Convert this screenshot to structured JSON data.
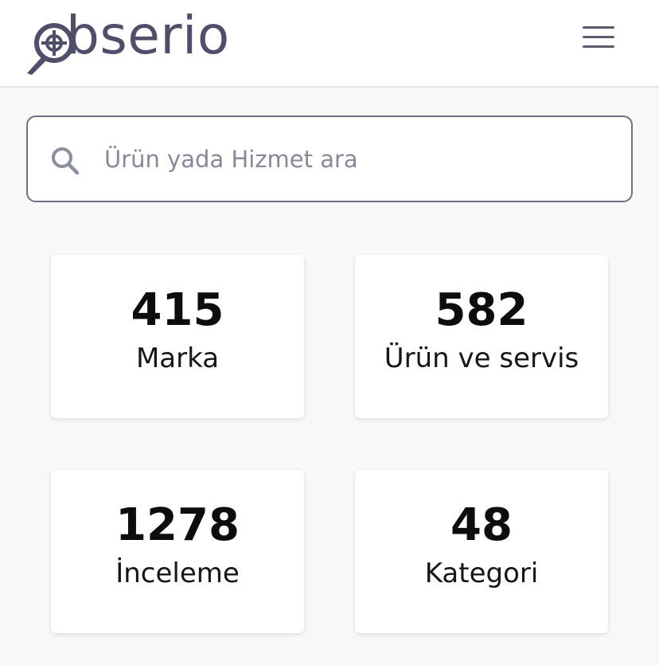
{
  "header": {
    "logo_text": "bserio",
    "logo_full": "obserio",
    "menu_icon": "hamburger-menu-icon",
    "brand_color": "#4f4f6a"
  },
  "search": {
    "placeholder": "Ürün yada Hizmet ara",
    "value": "",
    "icon": "search-icon"
  },
  "stats": [
    {
      "value": "415",
      "label": "Marka"
    },
    {
      "value": "582",
      "label": "Ürün ve servis"
    },
    {
      "value": "1278",
      "label": "İnceleme"
    },
    {
      "value": "48",
      "label": "Kategori"
    }
  ]
}
